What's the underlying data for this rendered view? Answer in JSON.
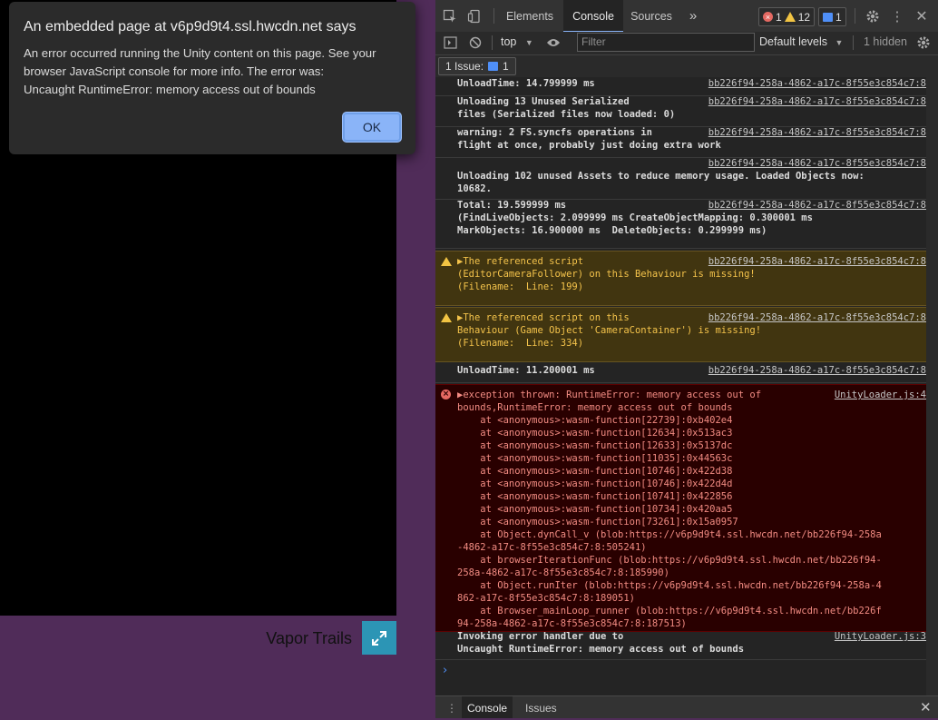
{
  "page": {
    "game_title": "Vapor Trails"
  },
  "alert": {
    "title": "An embedded page at v6p9d9t4.ssl.hwcdn.net says",
    "body_lines": [
      "An error occurred running the Unity content on this page. See your",
      "browser JavaScript console for more info. The error was:",
      "Uncaught RuntimeError: memory access out of bounds"
    ],
    "ok_label": "OK"
  },
  "devtools": {
    "tabs": [
      "Elements",
      "Console",
      "Sources"
    ],
    "active_tab": "Console",
    "more_tabs": "»",
    "errors_count": "1",
    "warnings_count": "12",
    "issues_count": "1",
    "context": "top",
    "filter_placeholder": "Filter",
    "levels": "Default levels",
    "hidden": "1 hidden",
    "issues_label": "1 Issue:",
    "issues_pill_count": "1",
    "drawer_tabs": [
      "Console",
      "Issues"
    ],
    "prompt": "›"
  },
  "console": {
    "messages": [
      {
        "type": "log",
        "lines": [
          "UnloadTime: 14.799999 ms"
        ],
        "source": "bb226f94-258a-4862-a17c-8f55e3c854c7:8"
      },
      {
        "type": "log",
        "lines": [
          "Unloading 13 Unused Serialized",
          "files (Serialized files now loaded: 0)"
        ],
        "source": "bb226f94-258a-4862-a17c-8f55e3c854c7:8"
      },
      {
        "type": "log",
        "lines": [
          "warning: 2 FS.syncfs operations in",
          "flight at once, probably just doing extra work"
        ],
        "source": "bb226f94-258a-4862-a17c-8f55e3c854c7:8"
      },
      {
        "type": "log",
        "lines": [
          "",
          "Unloading 102 unused Assets to reduce memory usage. Loaded Objects now:",
          "10682."
        ],
        "source": "bb226f94-258a-4862-a17c-8f55e3c854c7:8"
      },
      {
        "type": "log",
        "lines": [
          "Total: 19.599999 ms",
          "(FindLiveObjects: 2.099999 ms CreateObjectMapping: 0.300001 ms",
          "MarkObjects: 16.900000 ms  DeleteObjects: 0.299999 ms)"
        ],
        "source": "bb226f94-258a-4862-a17c-8f55e3c854c7:8"
      },
      {
        "type": "warn",
        "lines": [
          "▶The referenced script",
          "(EditorCameraFollower) on this Behaviour is missing!",
          "(Filename:  Line: 199)"
        ],
        "source": "bb226f94-258a-4862-a17c-8f55e3c854c7:8"
      },
      {
        "type": "warn",
        "lines": [
          "▶The referenced script on this",
          "Behaviour (Game Object 'CameraContainer') is missing!",
          "(Filename:  Line: 334)"
        ],
        "source": "bb226f94-258a-4862-a17c-8f55e3c854c7:8"
      },
      {
        "type": "log",
        "lines": [
          "UnloadTime: 11.200001 ms"
        ],
        "source": "bb226f94-258a-4862-a17c-8f55e3c854c7:8"
      },
      {
        "type": "error",
        "lines": [
          "▶exception thrown: RuntimeError: memory access out of",
          "bounds,RuntimeError: memory access out of bounds",
          "    at <anonymous>:wasm-function[22739]:0xb402e4",
          "    at <anonymous>:wasm-function[12634]:0x513ac3",
          "    at <anonymous>:wasm-function[12633]:0x5137dc",
          "    at <anonymous>:wasm-function[11035]:0x44563c",
          "    at <anonymous>:wasm-function[10746]:0x422d38",
          "    at <anonymous>:wasm-function[10746]:0x422d4d",
          "    at <anonymous>:wasm-function[10741]:0x422856",
          "    at <anonymous>:wasm-function[10734]:0x420aa5",
          "    at <anonymous>:wasm-function[73261]:0x15a0957",
          "    at Object.dynCall_v (blob:https://v6p9d9t4.ssl.hwcdn.net/bb226f94-258a",
          "-4862-a17c-8f55e3c854c7:8:505241)",
          "    at browserIterationFunc (blob:https://v6p9d9t4.ssl.hwcdn.net/bb226f94-",
          "258a-4862-a17c-8f55e3c854c7:8:185990)",
          "    at Object.runIter (blob:https://v6p9d9t4.ssl.hwcdn.net/bb226f94-258a-4",
          "862-a17c-8f55e3c854c7:8:189051)",
          "    at Browser_mainLoop_runner (blob:https://v6p9d9t4.ssl.hwcdn.net/bb226f",
          "94-258a-4862-a17c-8f55e3c854c7:8:187513)"
        ],
        "source": "UnityLoader.js:4"
      },
      {
        "type": "log",
        "lines": [
          "Invoking error handler due to",
          "Uncaught RuntimeError: memory access out of bounds"
        ],
        "source": "UnityLoader.js:3"
      }
    ]
  }
}
